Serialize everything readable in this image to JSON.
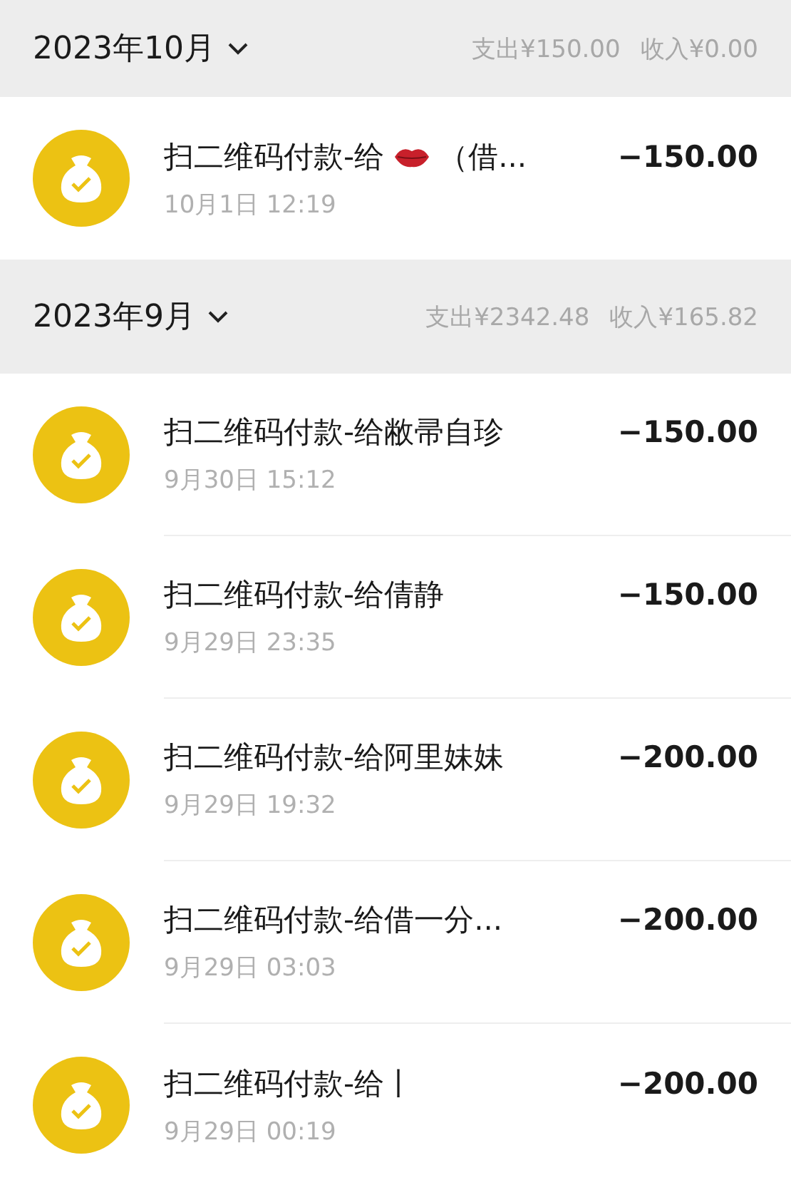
{
  "months": [
    {
      "title": "2023年10月",
      "expanded": false,
      "expense": "支出¥150.00",
      "income": "收入¥0.00",
      "transactions": [
        {
          "title": "扫二维码付款-给",
          "has_icon": true,
          "title_suffix": "（借...",
          "time": "10月1日 12:19",
          "amount": "−150.00"
        }
      ]
    },
    {
      "title": "2023年9月",
      "expanded": false,
      "expense": "支出¥2342.48",
      "income": "收入¥165.82",
      "transactions": [
        {
          "title": "扫二维码付款-给敝帚自珍",
          "time": "9月30日 15:12",
          "amount": "−150.00"
        },
        {
          "title": "扫二维码付款-给倩静",
          "time": "9月29日 23:35",
          "amount": "−150.00"
        },
        {
          "title": "扫二维码付款-给阿里妹妹",
          "time": "9月29日 19:32",
          "amount": "−200.00"
        },
        {
          "title": "扫二维码付款-给借一分...",
          "time": "9月29日 03:03",
          "amount": "−200.00"
        },
        {
          "title": "扫二维码付款-给丨",
          "time": "9月29日 00:19",
          "amount": "−200.00"
        }
      ]
    }
  ]
}
